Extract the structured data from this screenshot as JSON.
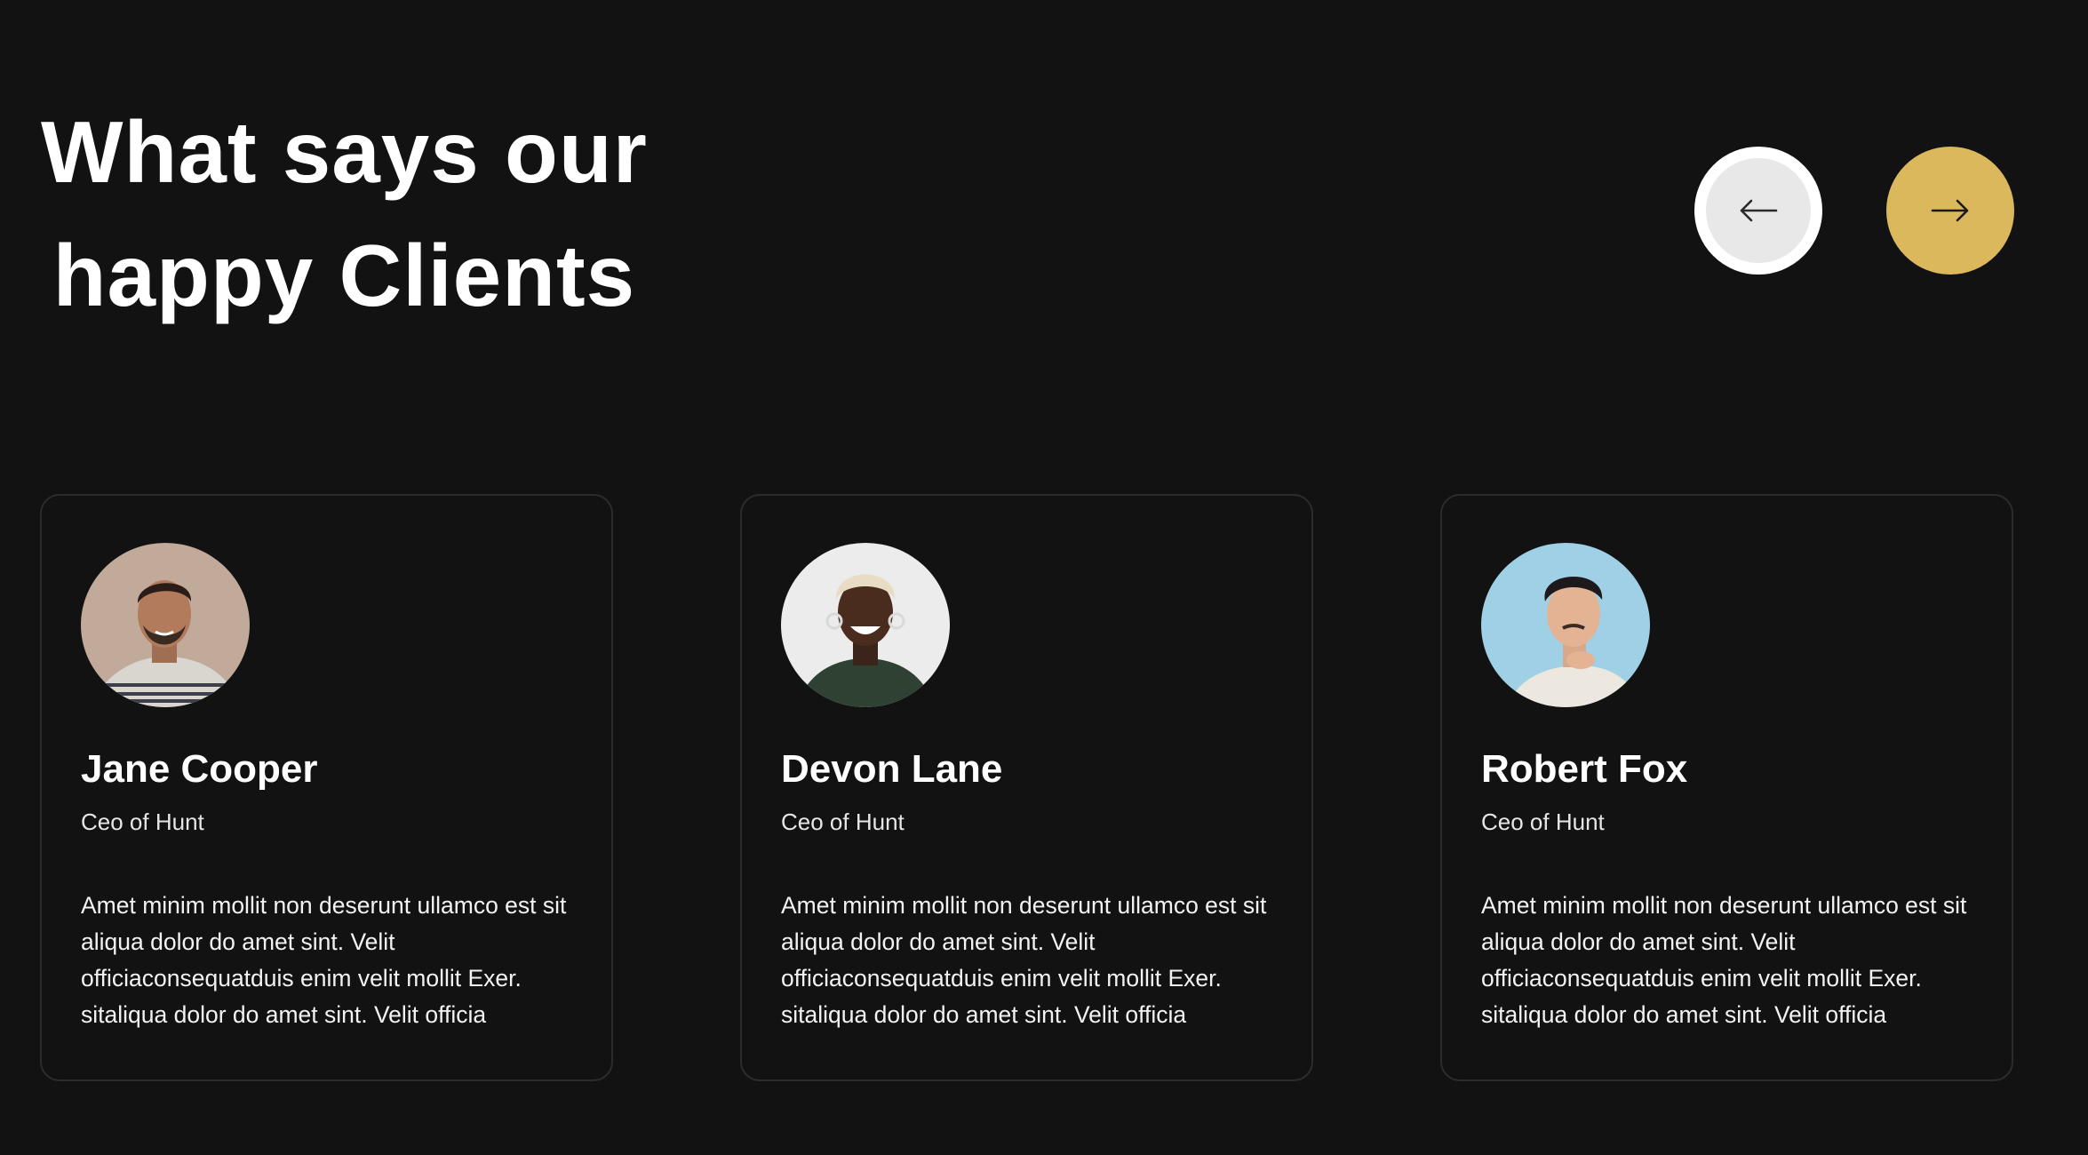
{
  "section": {
    "heading_line1": "What says our",
    "heading_line2": "happy Clients"
  },
  "nav": {
    "prev_icon": "arrow-left-icon",
    "next_icon": "arrow-right-icon",
    "prev_bg": "#e8e8e8",
    "next_bg": "#dcb85c"
  },
  "testimonials": [
    {
      "name": "Jane Cooper",
      "role": "Ceo of Hunt",
      "quote_lines": [
        "Amet minim mollit non deserunt ullamco est sit",
        "aliqua dolor do amet sint. Velit",
        "officiaconsequatduis enim velit mollit Exer.",
        "sitaliqua dolor do amet sint. Velit officia"
      ]
    },
    {
      "name": "Devon Lane",
      "role": "Ceo of Hunt",
      "quote_lines": [
        "Amet minim mollit non deserunt ullamco est sit",
        "aliqua dolor do amet sint. Velit",
        "officiaconsequatduis enim velit mollit Exer.",
        "sitaliqua dolor do amet sint. Velit officia"
      ]
    },
    {
      "name": "Robert Fox",
      "role": "Ceo of Hunt",
      "quote_lines": [
        "Amet minim mollit non deserunt ullamco est sit",
        "aliqua dolor do amet sint. Velit",
        "officiaconsequatduis enim velit mollit Exer.",
        "sitaliqua dolor do amet sint. Velit officia"
      ]
    }
  ],
  "colors": {
    "background": "#121212",
    "accent": "#dcb85c",
    "card_border": "#2c2c2c"
  }
}
